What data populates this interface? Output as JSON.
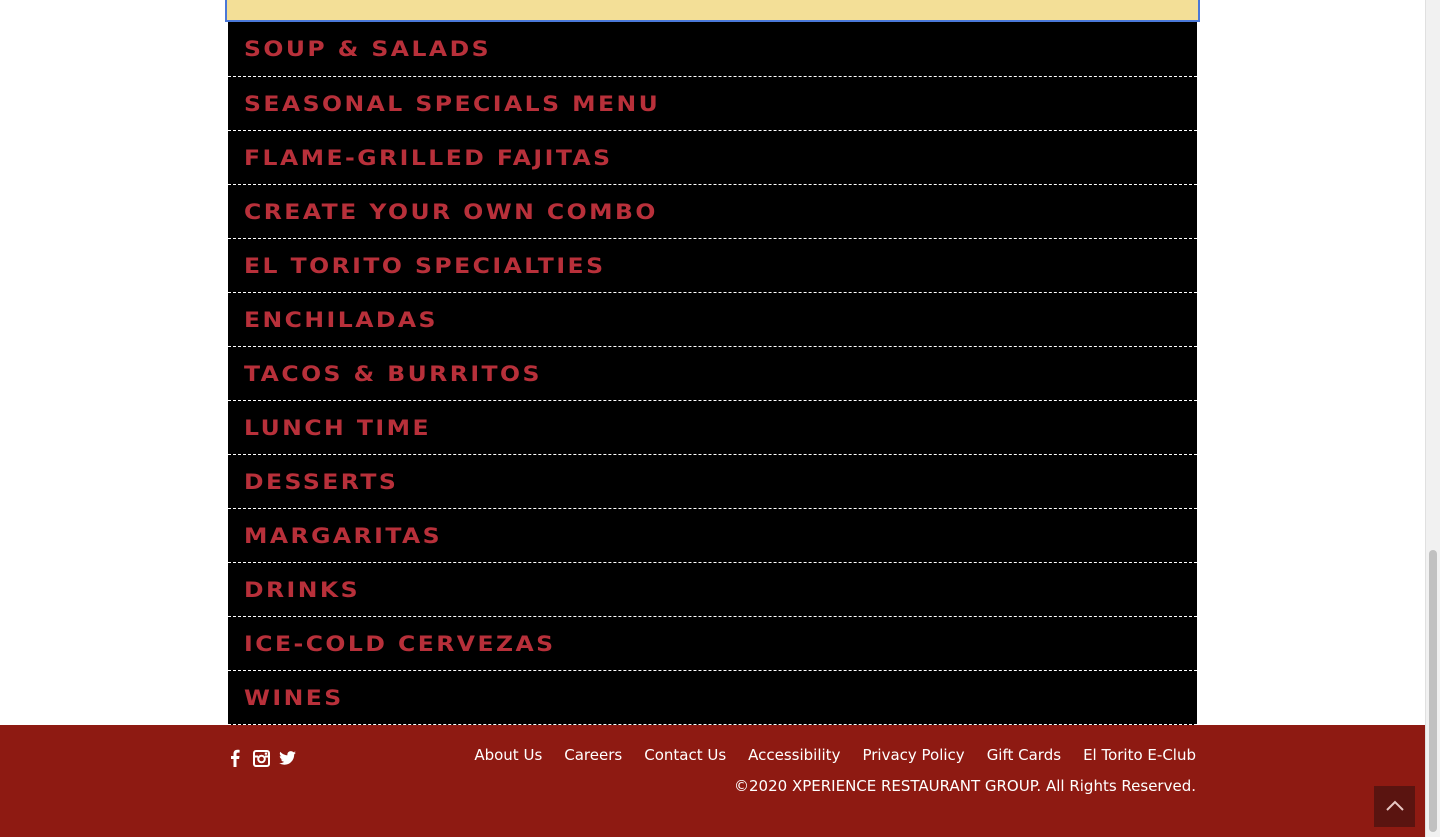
{
  "menu": {
    "items": [
      "SOUP & SALADS",
      "SEASONAL SPECIALS MENU",
      "FLAME-GRILLED FAJITAS",
      "CREATE YOUR OWN COMBO",
      "EL TORITO SPECIALTIES",
      "ENCHILADAS",
      "TACOS & BURRITOS",
      "LUNCH TIME",
      "DESSERTS",
      "MARGARITAS",
      "DRINKS",
      "ICE-COLD CERVEZAS",
      "WINES"
    ]
  },
  "footer": {
    "links": [
      "About Us",
      "Careers",
      "Contact Us",
      "Accessibility",
      "Privacy Policy",
      "Gift Cards",
      "El Torito E-Club"
    ],
    "copyright": "©2020 XPERIENCE RESTAURANT GROUP. All Rights Reserved.",
    "social_icons": [
      "facebook-icon",
      "instagram-icon",
      "twitter-icon"
    ]
  },
  "colors": {
    "menu_text": "#b8303a",
    "menu_bg": "#000000",
    "active_bar": "#f3df97",
    "footer_bg": "#8e1a12"
  }
}
